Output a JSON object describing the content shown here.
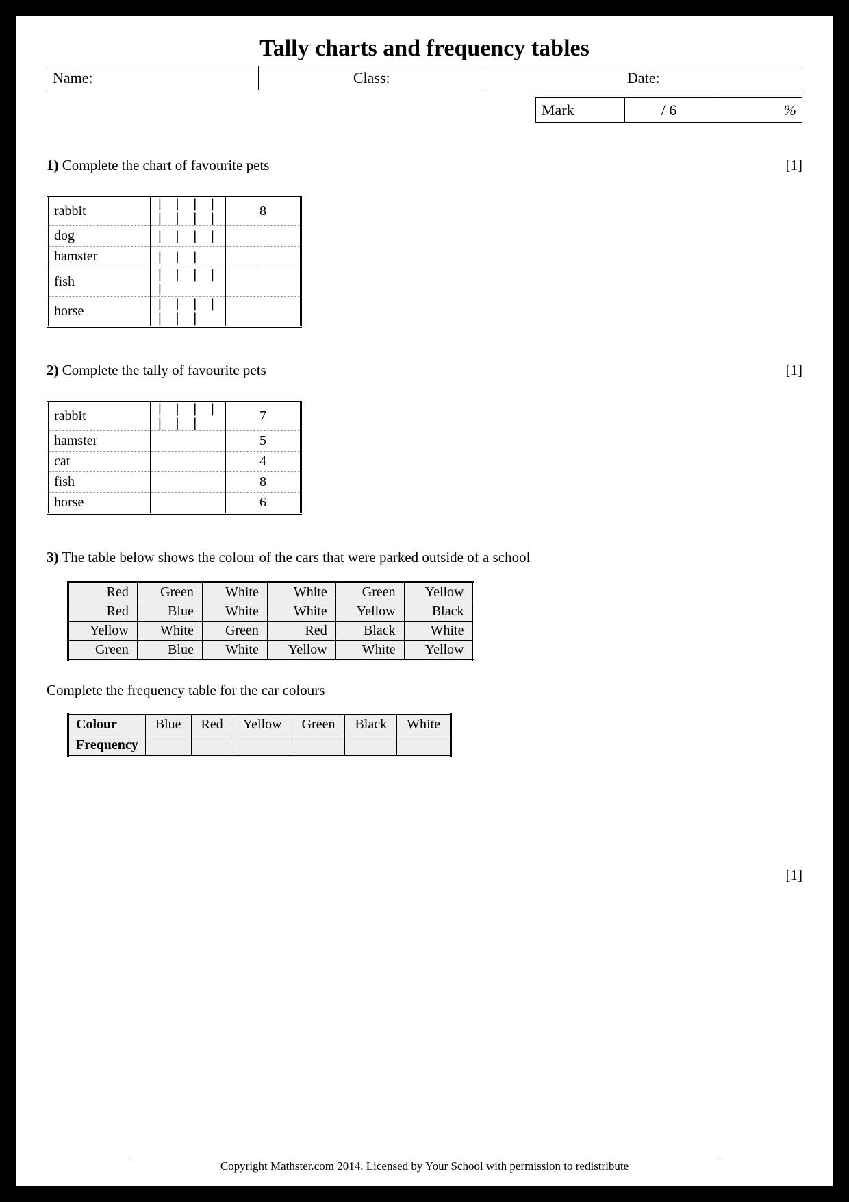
{
  "title": "Tally charts and frequency tables",
  "header": {
    "name_label": "Name:",
    "class_label": "Class:",
    "date_label": "Date:",
    "mark_label": "Mark",
    "mark_total": "/ 6",
    "mark_pct": "%"
  },
  "q1": {
    "num": "1)",
    "text": " Complete the chart of favourite pets",
    "pts": "[1]",
    "rows": [
      {
        "label": "rabbit",
        "tally": "| | | | | | | |",
        "freq": "8"
      },
      {
        "label": "dog",
        "tally": "| | | |",
        "freq": ""
      },
      {
        "label": "hamster",
        "tally": "| | |",
        "freq": ""
      },
      {
        "label": "fish",
        "tally": "| | | | |",
        "freq": ""
      },
      {
        "label": "horse",
        "tally": "| | | | | | |",
        "freq": ""
      }
    ]
  },
  "q2": {
    "num": "2)",
    "text": " Complete the tally of favourite pets",
    "pts": "[1]",
    "rows": [
      {
        "label": "rabbit",
        "tally": "| | | | | | |",
        "freq": "7"
      },
      {
        "label": "hamster",
        "tally": "",
        "freq": "5"
      },
      {
        "label": "cat",
        "tally": "",
        "freq": "4"
      },
      {
        "label": "fish",
        "tally": "",
        "freq": "8"
      },
      {
        "label": "horse",
        "tally": "",
        "freq": "6"
      }
    ]
  },
  "q3": {
    "num": "3)",
    "text": " The table below shows the colour of the cars that were parked outside of a school",
    "cars": [
      [
        "Red",
        "Green",
        "White",
        "White",
        "Green",
        "Yellow"
      ],
      [
        "Red",
        "Blue",
        "White",
        "White",
        "Yellow",
        "Black"
      ],
      [
        "Yellow",
        "White",
        "Green",
        "Red",
        "Black",
        "White"
      ],
      [
        "Green",
        "Blue",
        "White",
        "Yellow",
        "White",
        "Yellow"
      ]
    ],
    "subtext": "Complete the frequency table for the car colours",
    "freq_head": [
      "Colour",
      "Blue",
      "Red",
      "Yellow",
      "Green",
      "Black",
      "White"
    ],
    "freq_row_label": "Frequency",
    "pts": "[1]"
  },
  "footer": "Copyright Mathster.com 2014. Licensed by Your School with permission to redistribute"
}
